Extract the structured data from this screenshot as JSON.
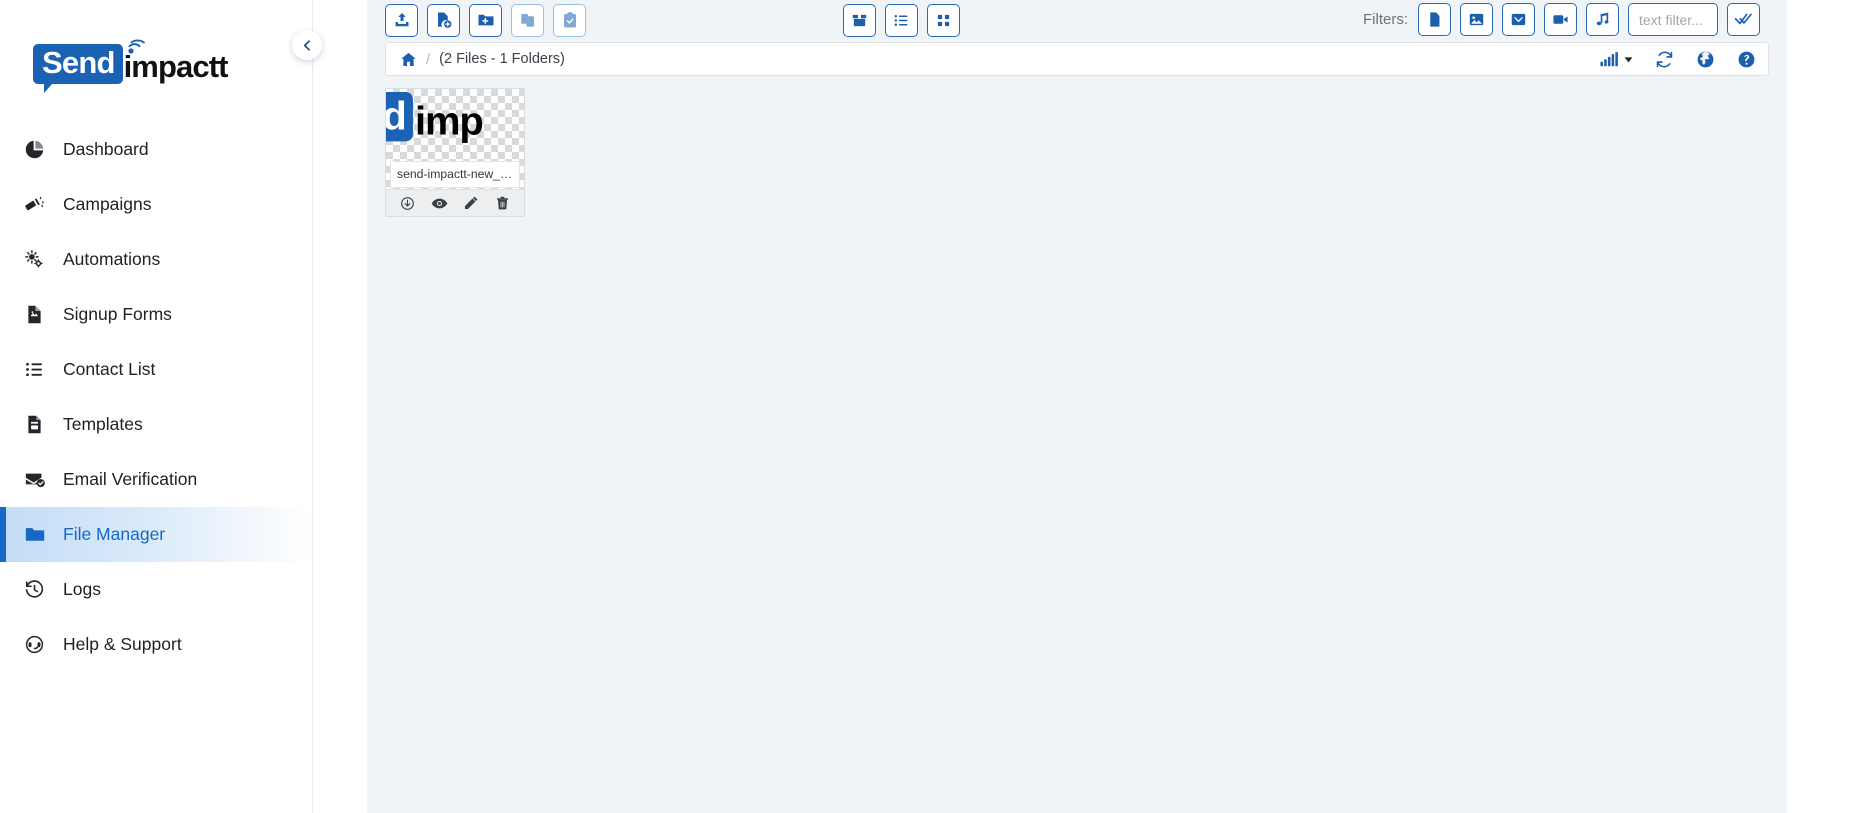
{
  "brand": {
    "logo_send": "Send",
    "logo_impactt": "impactt",
    "accent_color": "#1b61b4",
    "active_color": "#1668c4"
  },
  "sidebar": {
    "collapse_icon": "chevron-left-icon",
    "items": [
      {
        "label": "Dashboard",
        "icon": "pie-chart-icon",
        "active": false
      },
      {
        "label": "Campaigns",
        "icon": "megaphone-icon",
        "active": false
      },
      {
        "label": "Automations",
        "icon": "gears-icon",
        "active": false
      },
      {
        "label": "Signup Forms",
        "icon": "form-document-icon",
        "active": false
      },
      {
        "label": "Contact List",
        "icon": "list-icon",
        "active": false
      },
      {
        "label": "Templates",
        "icon": "template-file-icon",
        "active": false
      },
      {
        "label": "Email Verification",
        "icon": "envelope-check-icon",
        "active": false
      },
      {
        "label": "File Manager",
        "icon": "folder-icon",
        "active": true
      },
      {
        "label": "Logs",
        "icon": "history-clock-icon",
        "active": false
      },
      {
        "label": "Help & Support",
        "icon": "headset-icon",
        "active": false
      }
    ]
  },
  "toolbar": {
    "actions": [
      {
        "name": "upload-button",
        "icon": "upload-icon",
        "disabled": false
      },
      {
        "name": "new-file-button",
        "icon": "file-plus-icon",
        "disabled": false
      },
      {
        "name": "new-folder-button",
        "icon": "folder-plus-icon",
        "disabled": false
      },
      {
        "name": "paste-button",
        "icon": "paste-icon",
        "disabled": true
      },
      {
        "name": "clipboard-button",
        "icon": "clipboard-check-icon",
        "disabled": true
      }
    ],
    "views": [
      {
        "name": "view-boxes-button",
        "icon": "box-icon"
      },
      {
        "name": "view-list-button",
        "icon": "list-view-icon"
      },
      {
        "name": "view-grid-button",
        "icon": "grid-view-icon"
      }
    ]
  },
  "filters": {
    "label": "Filters:",
    "types": [
      {
        "name": "filter-documents",
        "icon": "file-icon"
      },
      {
        "name": "filter-images",
        "icon": "image-icon"
      },
      {
        "name": "filter-archives",
        "icon": "archive-icon"
      },
      {
        "name": "filter-videos",
        "icon": "video-icon"
      },
      {
        "name": "filter-audio",
        "icon": "music-icon"
      }
    ],
    "text_value": "",
    "text_placeholder": "text filter...",
    "select_all_icon": "double-check-icon"
  },
  "breadcrumb": {
    "home_icon": "home-icon",
    "separator": "/",
    "count_text": "(2 Files - 1 Folders)",
    "tools": [
      {
        "name": "usage-bars-button",
        "icon": "signal-bars-icon"
      },
      {
        "name": "refresh-button",
        "icon": "refresh-icon"
      },
      {
        "name": "language-button",
        "icon": "globe-icon"
      },
      {
        "name": "help-button",
        "icon": "question-circle-icon"
      }
    ]
  },
  "files": [
    {
      "name": "send-impactt-new_…",
      "thumb_type": "image-thumbnail",
      "thumb_send": "d",
      "thumb_imp": "imp",
      "actions": [
        {
          "name": "download-action",
          "icon": "download-circle-icon"
        },
        {
          "name": "preview-action",
          "icon": "eye-icon"
        },
        {
          "name": "rename-action",
          "icon": "pencil-icon"
        },
        {
          "name": "delete-action",
          "icon": "trash-icon"
        }
      ]
    }
  ]
}
